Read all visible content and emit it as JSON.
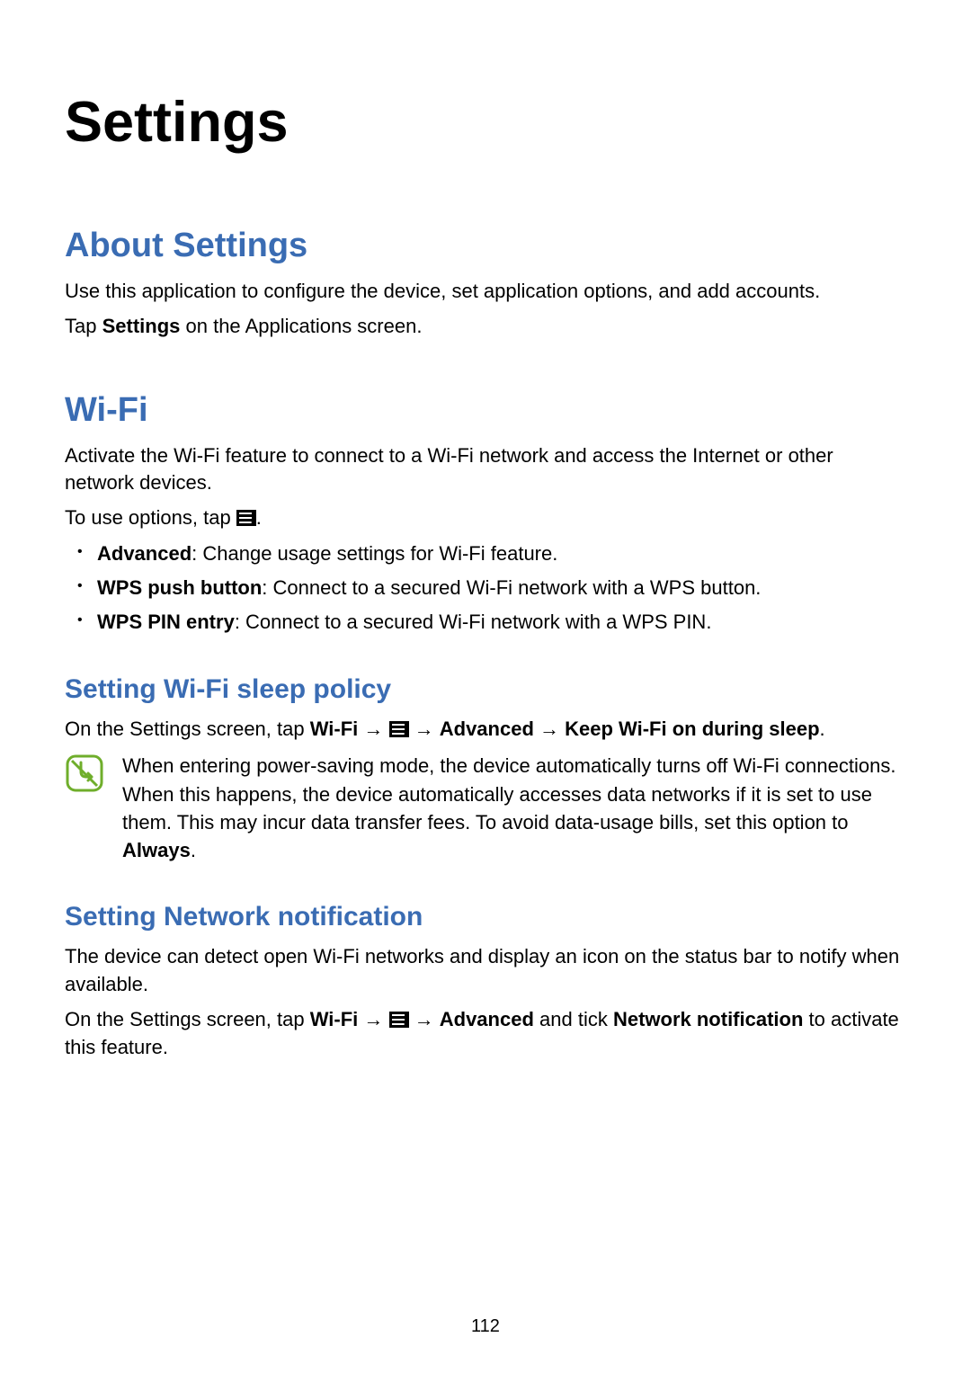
{
  "page_number": "112",
  "chapter_title": "Settings",
  "about": {
    "heading": "About Settings",
    "p1": "Use this application to configure the device, set application options, and add accounts.",
    "p2_pre": "Tap ",
    "p2_bold": "Settings",
    "p2_post": " on the Applications screen."
  },
  "wifi": {
    "heading": "Wi-Fi",
    "intro": "Activate the Wi-Fi feature to connect to a Wi-Fi network and access the Internet or other network devices.",
    "options_pre": "To use options, tap ",
    "options_post": ".",
    "items": [
      {
        "label": "Advanced",
        "desc": ": Change usage settings for Wi-Fi feature."
      },
      {
        "label": "WPS push button",
        "desc": ": Connect to a secured Wi-Fi network with a WPS button."
      },
      {
        "label": "WPS PIN entry",
        "desc": ": Connect to a secured Wi-Fi network with a WPS PIN."
      }
    ],
    "sleep": {
      "heading": "Setting Wi-Fi sleep policy",
      "p_pre": "On the Settings screen, tap ",
      "p_wifi": "Wi-Fi",
      "p_arrow1": " → ",
      "p_arrow2": " → ",
      "p_advanced": "Advanced",
      "p_keep": "Keep Wi-Fi on during sleep",
      "p_post": ".",
      "note_pre": "When entering power-saving mode, the device automatically turns off Wi-Fi connections. When this happens, the device automatically accesses data networks if it is set to use them. This may incur data transfer fees. To avoid data-usage bills, set this option to ",
      "note_bold": "Always",
      "note_post": "."
    },
    "netnotif": {
      "heading": "Setting Network notification",
      "p1": "The device can detect open Wi-Fi networks and display an icon on the status bar to notify when available.",
      "p2_pre": "On the Settings screen, tap ",
      "p2_wifi": "Wi-Fi",
      "p2_arrow1": " → ",
      "p2_arrow2": " → ",
      "p2_advanced": "Advanced",
      "p2_mid": " and tick ",
      "p2_netnotif": "Network notification",
      "p2_post": " to activate this feature."
    }
  }
}
